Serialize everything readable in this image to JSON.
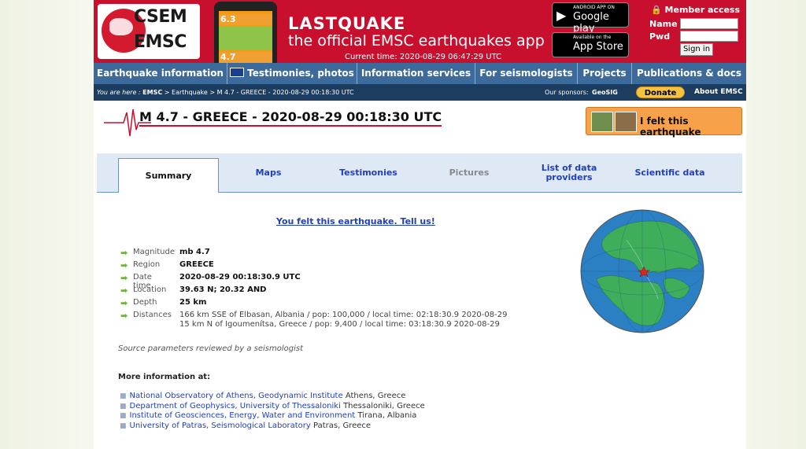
{
  "header": {
    "logo_top": "CSEM",
    "logo_bottom": "EMSC",
    "app_title": "LASTQUAKE",
    "app_subtitle": "the official EMSC earthquakes app",
    "current_time": "Current time: 2020-08-29 06:47:29 UTC",
    "phone_rows": [
      "6.3",
      "4.7"
    ],
    "google_play_small": "ANDROID APP ON",
    "google_play_big": "Google play",
    "app_store_small": "Available on the",
    "app_store_big": "App Store",
    "member_access": "Member access",
    "name_label": "Name",
    "pwd_label": "Pwd",
    "sign_in": "Sign in"
  },
  "nav": {
    "items": [
      "Earthquake information",
      "Testimonies, photos",
      "Information services",
      "For seismologists",
      "Projects",
      "Publications & docs"
    ]
  },
  "breadcrumb": {
    "prefix": "You are here :",
    "emsc": "EMSC",
    "sep1": ">",
    "earthquake": "Earthquake",
    "sep2": ">",
    "current": "M 4.7 - GREECE - 2020-08-29 00:18:30 UTC",
    "sponsors_label": "Our sponsors:",
    "sponsor": "GeoSIG",
    "donate": "Donate",
    "about": "About EMSC"
  },
  "event": {
    "title": "M 4.7 - GREECE - 2020-08-29 00:18:30 UTC",
    "felt_button": "I felt this earthquake"
  },
  "tabs": {
    "summary": "Summary",
    "maps": "Maps",
    "testimonies": "Testimonies",
    "pictures": "Pictures",
    "data_providers": "List of data providers",
    "scientific": "Scientific data"
  },
  "summary": {
    "felt_link": "You felt this earthquake. Tell us!",
    "rows": [
      {
        "key": "Magnitude",
        "value": "mb 4.7"
      },
      {
        "key": "Region",
        "value": "GREECE"
      },
      {
        "key": "Date time",
        "value": "2020-08-29 00:18:30.9 UTC"
      },
      {
        "key": "Location",
        "value": "39.63 N; 20.32 AND"
      },
      {
        "key": "Depth",
        "value": "25 km"
      },
      {
        "key": "Distances",
        "line1": "166 km SSE of Elbasan, Albania / pop: 100,000 / local time: 02:18:30.9 2020-08-29",
        "line2": "15 km N of Igoumenítsa, Greece / pop: 9,400 / local time: 03:18:30.9 2020-08-29"
      }
    ],
    "reviewed": "Source parameters reviewed by a seismologist",
    "more_info_title": "More information at:",
    "institutions": [
      {
        "name": "National Observatory of Athens, Geodynamic Institute",
        "place": "Athens, Greece"
      },
      {
        "name": "Department of Geophysics, University of Thessaloniki",
        "place": "Thessaloniki, Greece"
      },
      {
        "name": "Institute of Geosciences, Energy, Water and Environment",
        "place": "Tirana, Albania"
      },
      {
        "name": "University of Patras, Seismological Laboratory",
        "place": "Patras, Greece"
      }
    ]
  },
  "colors": {
    "header_red": "#c8102e",
    "nav_blue": "#3c6a9b",
    "crumb_navy": "#1c3d60",
    "link_blue": "#1f3fbf",
    "felt_orange": "#f7a24a",
    "map_ocean": "#2b7fc3",
    "map_land": "#3fae5a",
    "epicenter": "#e0261c"
  }
}
